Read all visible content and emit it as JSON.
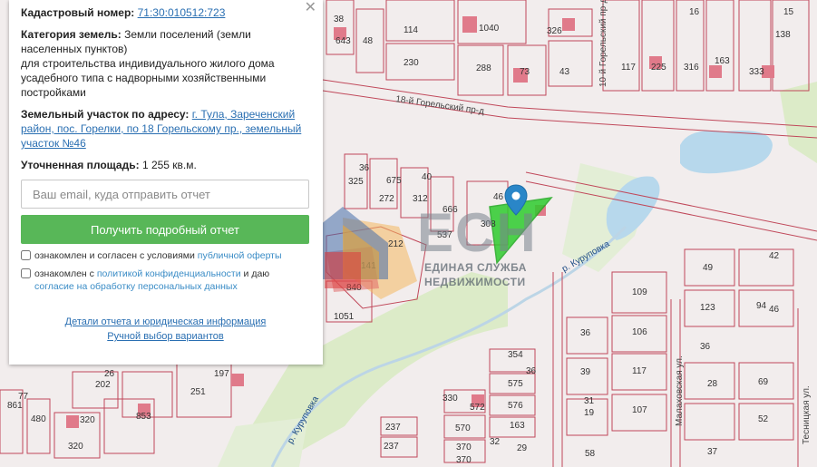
{
  "panel": {
    "cadastral_label": "Кадастровый номер:",
    "cadastral_value": "71:30:010512:723",
    "category_label": "Категория земель:",
    "category_value": "Земли поселений (земли населенных пунктов)",
    "usage_value": "для строительства индивидуального жилого дома усадебного типа с надворными хозяйственными постройками",
    "address_label": "Земельный участок по адресу:",
    "address_value": "г. Тула, Зареченский район, пос. Горелки, по 18 Горельскому пр., земельный участок №46",
    "area_label": "Уточненная площадь:",
    "area_value": "1 255 кв.м.",
    "email_placeholder": "Ваш email, куда отправить отчет",
    "submit_label": "Получить подробный отчет",
    "consent1_text": "ознакомлен и согласен с условиями",
    "consent1_link": "публичной оферты",
    "consent2_text": "ознакомлен с",
    "consent2_link": "политикой конфиденциальности",
    "consent2_mid": "и даю",
    "consent2_link2": "согласие на обработку персональных данных",
    "details_link": "Детали отчета и юридическая информация",
    "manual_link": "Ручной выбор вариантов",
    "close_symbol": "✕"
  },
  "logo": {
    "big": "ЕСН",
    "line1": "ЕДИНАЯ СЛУЖБА",
    "line2": "НЕДВИЖИМОСТИ"
  },
  "map": {
    "streets": [
      "18-й Горельский пр-д",
      "10-й Горельский пр-д",
      "р. Куруповка",
      "р. Куруповка",
      "Малаховская ул.",
      "Тесницкая ул."
    ],
    "parcel_labels": [
      "38",
      "643",
      "48",
      "114",
      "1040",
      "326",
      "16",
      "138",
      "230",
      "288",
      "73",
      "43",
      "117",
      "225",
      "316",
      "163",
      "333",
      "325",
      "36",
      "675",
      "40",
      "272",
      "312",
      "537",
      "666",
      "308",
      "212",
      "141",
      "840",
      "1051",
      "109",
      "49",
      "42",
      "123",
      "94",
      "106",
      "354",
      "36",
      "117",
      "39",
      "575",
      "576",
      "330",
      "572",
      "570",
      "36",
      "28",
      "69",
      "31",
      "19",
      "107",
      "52",
      "37",
      "320",
      "202",
      "251",
      "853",
      "480",
      "320",
      "26",
      "197",
      "861",
      "237",
      "370",
      "163",
      "32",
      "58",
      "29",
      "370",
      "237",
      "77",
      "36",
      "46",
      "15",
      "46"
    ]
  },
  "colors": {
    "parcel_border": "#c0485a",
    "building": "#e07a8a",
    "water": "#b7d8ec",
    "greenery": "#d8ebc6",
    "selected": "#2ecc2e",
    "pin": "#2a86c8",
    "button": "#58b758"
  },
  "icons": [
    "close-icon",
    "location-pin-icon",
    "logo-icon"
  ]
}
